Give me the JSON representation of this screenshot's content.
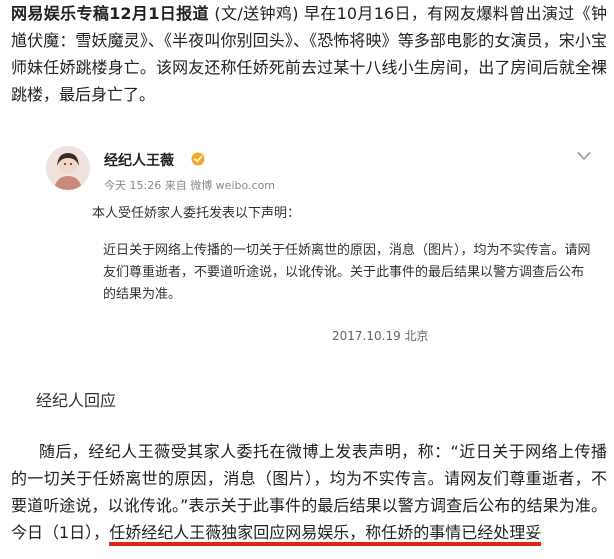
{
  "article": {
    "lead_bold": "网易娱乐专稿12月1日报道",
    "lead_rest": " (文/送钟鸡) 早在10月16日，有网友爆料曾出演过《钟馗伏魔：雪妖魔灵》、《半夜叫你别回头》、《恐怖将映》等多部电影的女演员，宋小宝师妹任娇跳楼身亡。该网友还称任娇死前去过某十八线小生房间，出了房间后就全裸跳楼，最后身亡了。"
  },
  "weibo_card": {
    "account_name": "经纪人王薇",
    "meta": "今天 15:26 来自 微博 weibo.com",
    "statement_head": "本人受任娇家人委托发表以下声明：",
    "statement_body": "近日关于网络上传播的一切关于任娇离世的原因，消息（图片），均为不实传言。请网友们尊重逝者，不要道听途说，以讹传讹。关于此事件的最后结果以警方调查后公布的结果为准。",
    "date_place": "2017.10.19 北京",
    "icons": [
      "avatar",
      "verified-badge-icon",
      "chevron-down-icon"
    ],
    "colors": {
      "verify": "#f5a623",
      "meta": "#8a8a8a"
    }
  },
  "section": {
    "heading": "经纪人回应"
  },
  "body": {
    "text_main": "随后，经纪人王薇受其家人委托在微博上发表声明，称：“近日关于网络上传播的一切关于任娇离世的原因，消息（图片），均为不实传言。请网友们尊重逝者，不要道听途说，以讹传讹。”表示关于此事件的最后结果以警方调查后公布的结果为准。今日（1日），",
    "text_highlight": "任娇经纪人王薇独家回应网易娱乐，称任娇的事情已经处理妥",
    "highlight_color": "#e2231a"
  }
}
